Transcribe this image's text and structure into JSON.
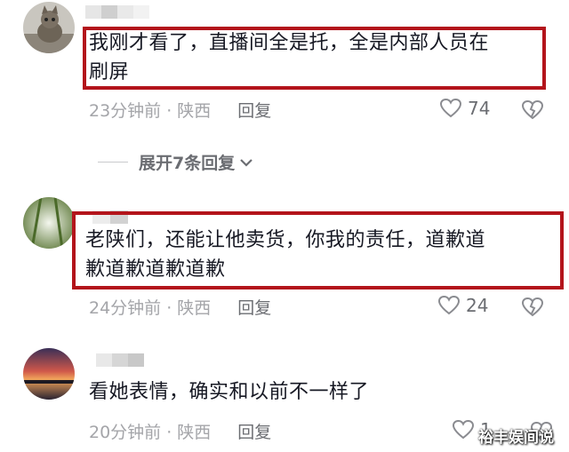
{
  "colors": {
    "highlight_border": "#b3141b",
    "meta_gray": "#a4a5a9",
    "text": "#161823"
  },
  "comments": [
    {
      "text": "我刚才看了，直播间全是托，全是内部人员在刷屏",
      "line1": "我刚才看了，直播间全是托，全是内部人员在",
      "line2": "刷屏",
      "time_location": "23分钟前 · 陕西",
      "reply_label": "回复",
      "like_count": "74"
    },
    {
      "text": "老陕们，还能让他卖货，你我的责任，道歉道歉道歉道歉道歉",
      "line1": "老陕们，还能让他卖货，你我的责任，道歉道",
      "line2": "歉道歉道歉道歉",
      "time_location": "24分钟前 · 陕西",
      "reply_label": "回复",
      "like_count": "24"
    },
    {
      "text": "看她表情，确实和以前不一样了",
      "time_location": "20分钟前 · 陕西",
      "reply_label": "回复",
      "like_count": "1"
    }
  ],
  "expand_replies": {
    "label": "展开7条回复"
  },
  "watermark": "裕丰娱间说",
  "icons": {
    "like": "heart-outline-icon",
    "dislike": "broken-heart-icon",
    "expand": "chevron-down-icon"
  }
}
